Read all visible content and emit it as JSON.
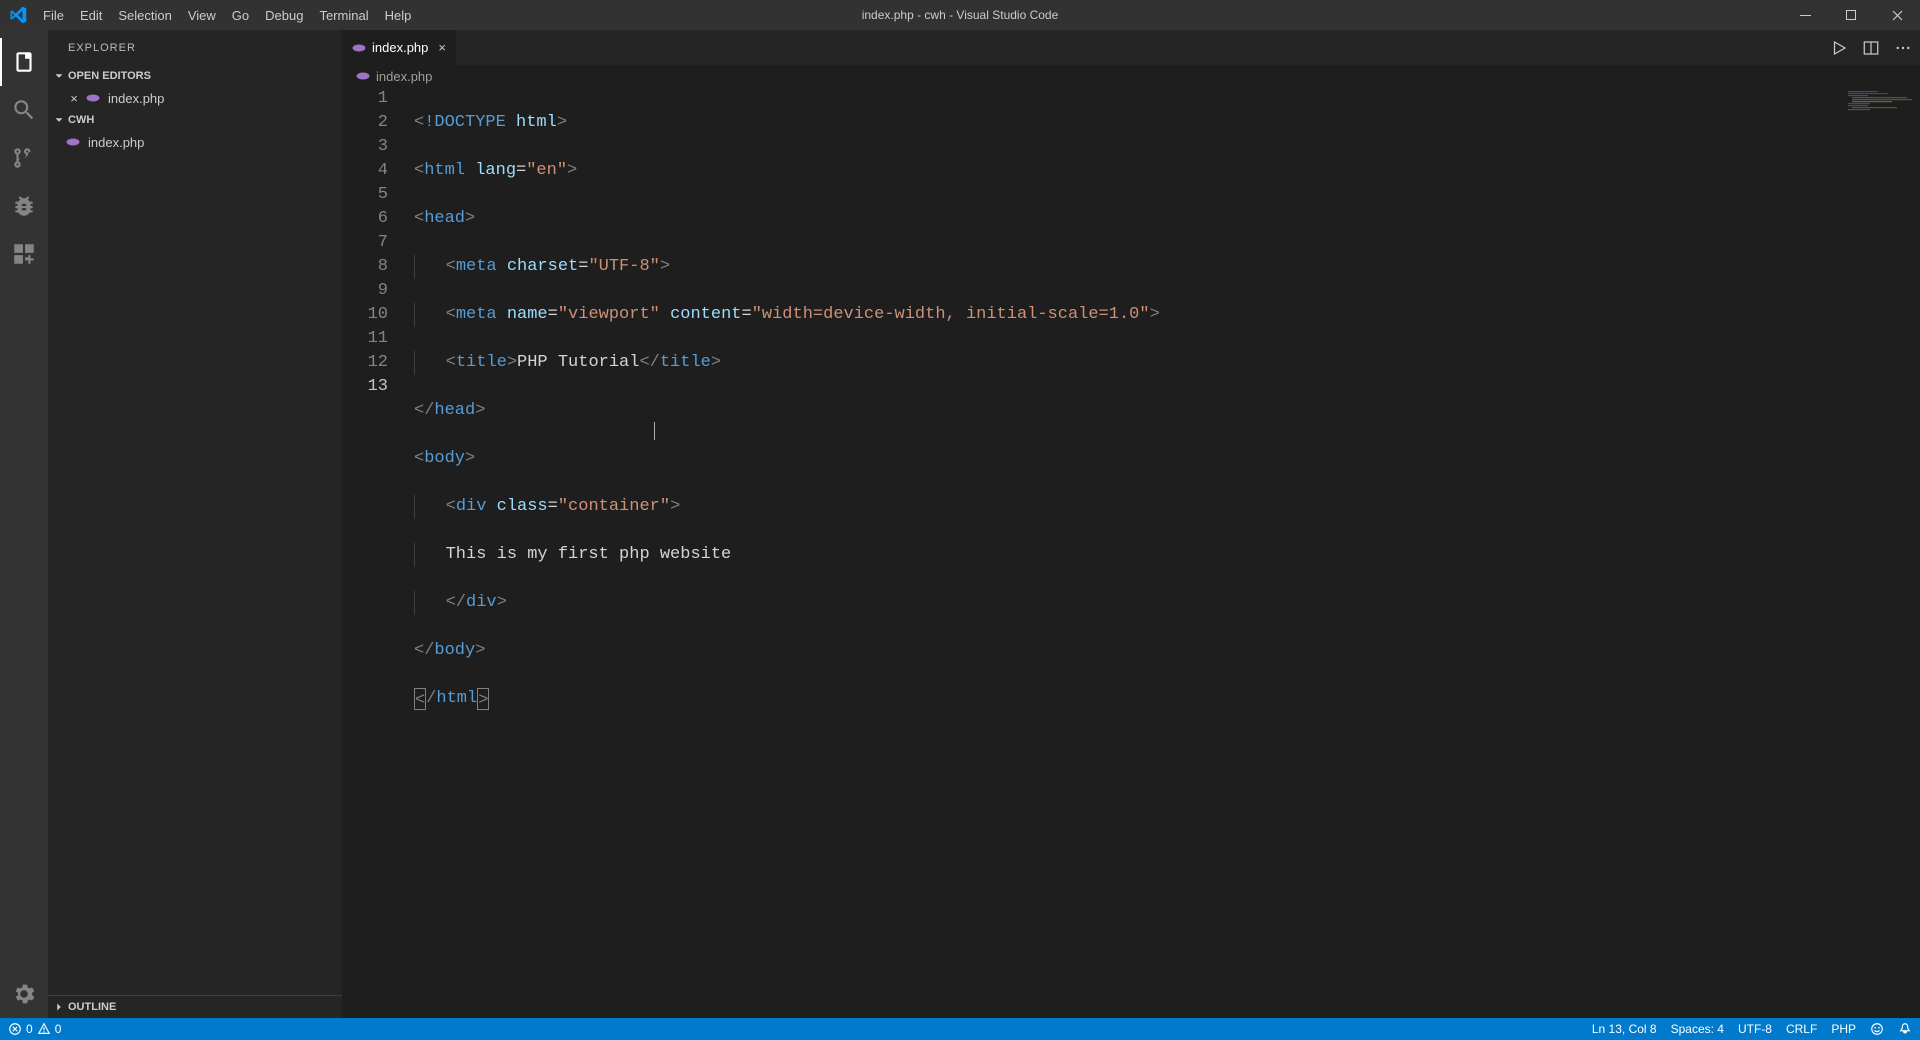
{
  "titlebar": {
    "title": "index.php - cwh - Visual Studio Code",
    "menus": [
      "File",
      "Edit",
      "Selection",
      "View",
      "Go",
      "Debug",
      "Terminal",
      "Help"
    ]
  },
  "sidebar": {
    "title": "EXPLORER",
    "openEditorsLabel": "OPEN EDITORS",
    "openEditors": [
      {
        "name": "index.php"
      }
    ],
    "workspaceLabel": "CWH",
    "files": [
      {
        "name": "index.php"
      }
    ],
    "outlineLabel": "OUTLINE"
  },
  "tab": {
    "name": "index.php"
  },
  "breadcrumb": {
    "name": "index.php"
  },
  "editor": {
    "lineCount": 13,
    "activeLine": 13,
    "code": {
      "line1_doctype": "!DOCTYPE",
      "line1_html": "html",
      "line2_tag": "html",
      "line2_attr": "lang",
      "line2_val": "\"en\"",
      "line3_tag": "head",
      "line4_tag": "meta",
      "line4_attr": "charset",
      "line4_val": "\"UTF-8\"",
      "line5_tag": "meta",
      "line5_attr1": "name",
      "line5_val1": "\"viewport\"",
      "line5_attr2": "content",
      "line5_val2": "\"width=device-width, initial-scale=1.0\"",
      "line6_tag": "title",
      "line6_text": "PHP Tutorial",
      "line7_tag": "head",
      "line8_tag": "body",
      "line9_tag": "div",
      "line9_attr": "class",
      "line9_val": "\"container\"",
      "line10_text": "This is my first php website",
      "line11_tag": "div",
      "line12_tag": "body",
      "line13_tag": "html"
    }
  },
  "status": {
    "errors": "0",
    "warnings": "0",
    "position": "Ln 13, Col 8",
    "spaces": "Spaces: 4",
    "encoding": "UTF-8",
    "eol": "CRLF",
    "language": "PHP"
  }
}
